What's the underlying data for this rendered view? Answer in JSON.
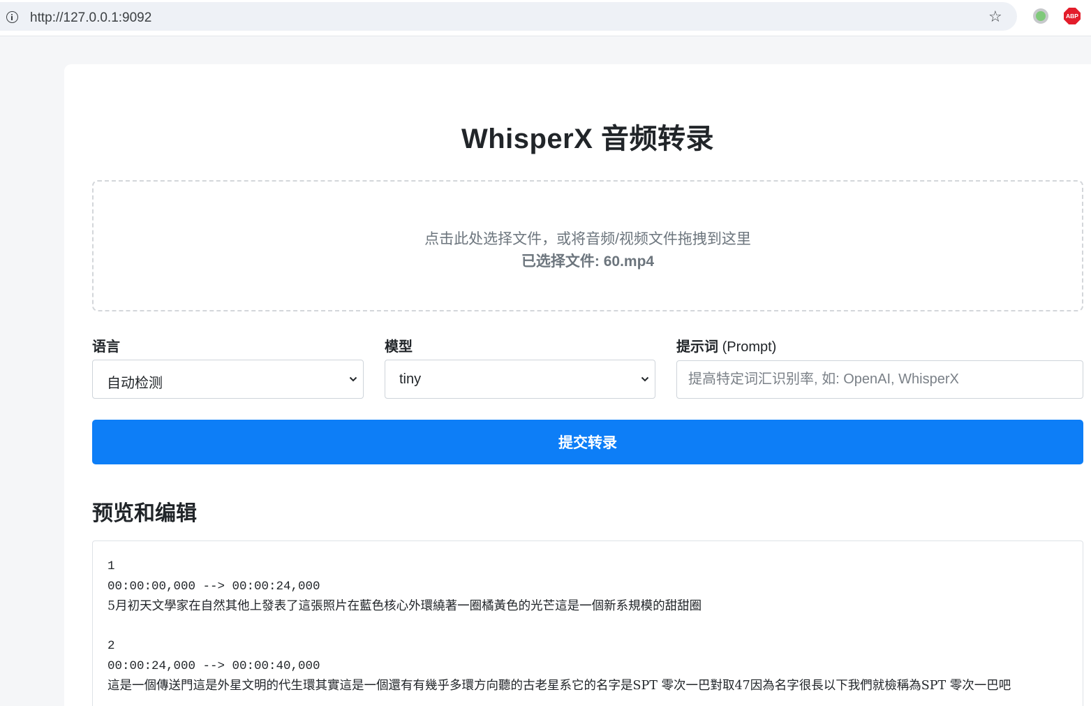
{
  "browser": {
    "url": "http://127.0.0.1:9092",
    "abp_label": "ABP"
  },
  "page": {
    "title": "WhisperX 音频转录"
  },
  "dropzone": {
    "hint": "点击此处选择文件，或将音频/视频文件拖拽到这里",
    "selected_file": "已选择文件: 60.mp4"
  },
  "form": {
    "language": {
      "label": "语言",
      "value": "自动检测"
    },
    "model": {
      "label": "模型",
      "value": "tiny"
    },
    "prompt": {
      "label_main": "提示词",
      "label_sub": "(Prompt)",
      "placeholder": "提高特定词汇识别率, 如: OpenAI, WhisperX"
    },
    "submit_label": "提交转录"
  },
  "preview": {
    "title": "预览和编辑",
    "entries": [
      {
        "index": "1",
        "time": "00:00:00,000 --> 00:00:24,000",
        "text": "5月初天文學家在自然其他上發表了這張照片在藍色核心外環繞著一圈橘黃色的光芒這是一個新系規模的甜甜圈"
      },
      {
        "index": "2",
        "time": "00:00:24,000 --> 00:00:40,000",
        "text": "這是一個傳送門這是外星文明的代生環其實這是一個還有有幾乎多環方向聽的古老星系它的名字是SPT 零次一巴對取47因為名字很長以下我們就檢稱為SPT 零次一巴吧"
      }
    ]
  }
}
